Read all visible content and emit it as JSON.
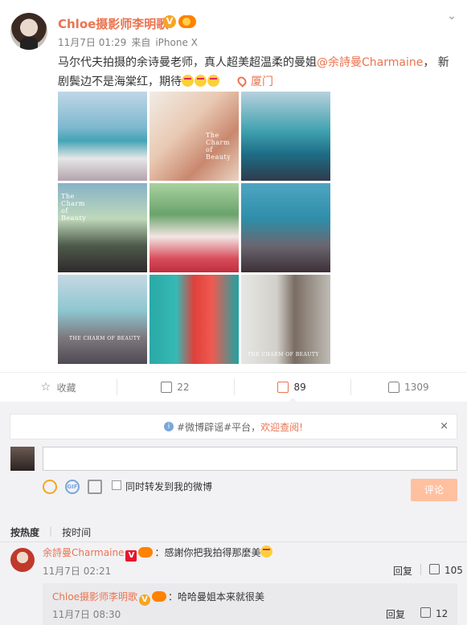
{
  "post": {
    "username": "Chloe摄影师李明歌",
    "verified_symbol": "V",
    "date": "11月7日 01:29",
    "source_prefix": "来自",
    "source": "iPhone X",
    "text_part1": "马尔代夫拍摄的余诗曼老师，真人超美超温柔的曼姐",
    "mention": "@余詩曼Charmaine",
    "text_part2": "， 新剧鬓边不是海棠红，期待",
    "location": "厦门",
    "photos": [
      {
        "caption": ""
      },
      {
        "caption": "The Charm of Beauty"
      },
      {
        "caption": ""
      },
      {
        "caption": "The Charm of Beauty"
      },
      {
        "caption": ""
      },
      {
        "caption": ""
      },
      {
        "caption": "THE CHARM OF BEAUTY"
      },
      {
        "caption": ""
      },
      {
        "caption": "THE CHARM OF BEAUTY"
      }
    ]
  },
  "actions": {
    "favorite": "收藏",
    "share_count": "22",
    "comment_count": "89",
    "like_count": "1309"
  },
  "comment_area": {
    "notice_prefix": "#微博辟谣#平台，",
    "notice_highlight": "欢迎查阅!",
    "close_symbol": "×",
    "gif_label": "GIF",
    "forward_label": "同时转发到我的微博",
    "submit_label": "评论",
    "sort_hot": "按热度",
    "sort_sep": "|",
    "sort_time": "按时间"
  },
  "comments": [
    {
      "username": "余詩曼Charmaine",
      "badge": "V",
      "text": "：感謝你把我拍得那麼美",
      "time": "11月7日 02:21",
      "reply_label": "回复",
      "likes": "105",
      "replies": [
        {
          "username": "Chloe摄影师李明歌",
          "badge": "V",
          "text": "：哈哈曼姐本来就很美",
          "time": "11月7日 08:30",
          "reply_label": "回复",
          "likes": "12"
        }
      ]
    }
  ],
  "colors": {
    "accent": "#eb7350",
    "submit_disabled": "#ffc09f",
    "panel_bg": "#f2f2f5"
  }
}
